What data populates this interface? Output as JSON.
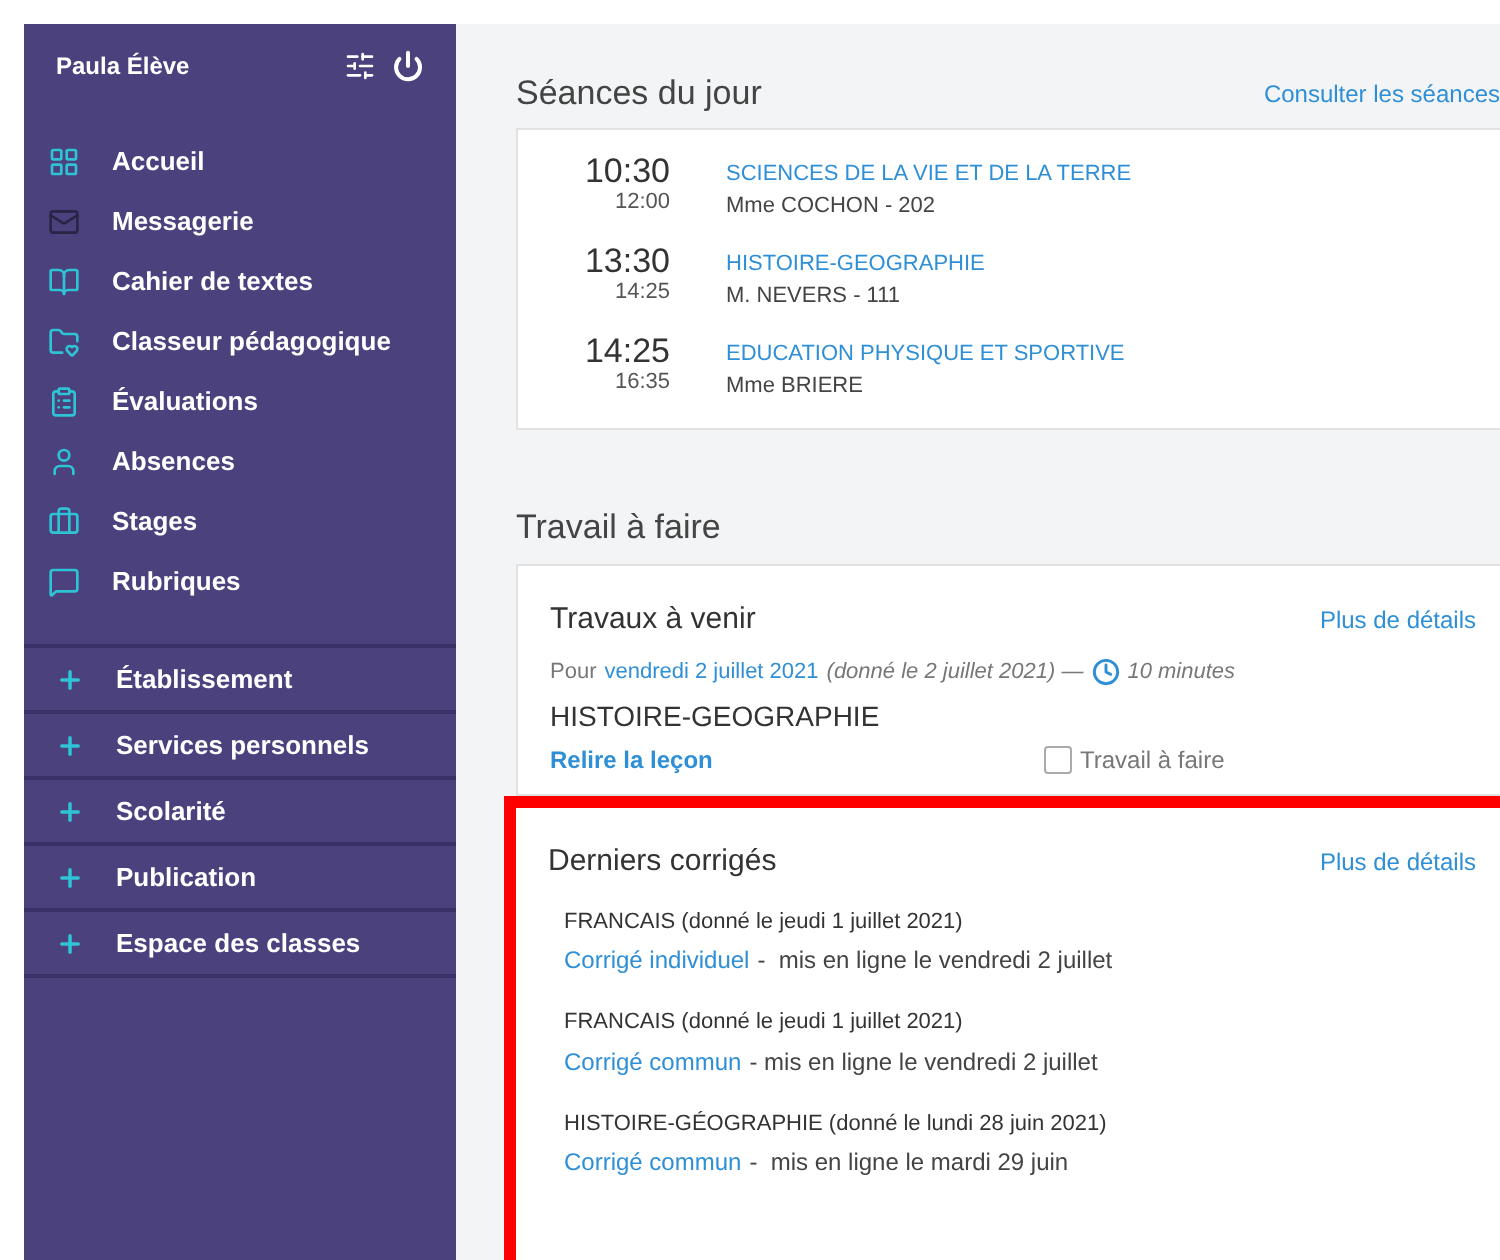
{
  "sidebar": {
    "user": "Paula Élève",
    "items": [
      {
        "label": "Accueil",
        "kind": "grid"
      },
      {
        "label": "Messagerie",
        "kind": "mail"
      },
      {
        "label": "Cahier de textes",
        "kind": "book"
      },
      {
        "label": "Classeur pédagogique",
        "kind": "folder"
      },
      {
        "label": "Évaluations",
        "kind": "clipboard"
      },
      {
        "label": "Absences",
        "kind": "person"
      },
      {
        "label": "Stages",
        "kind": "briefcase"
      },
      {
        "label": "Rubriques",
        "kind": "chat"
      }
    ],
    "sections": [
      {
        "label": "Établissement",
        "expanded": false
      },
      {
        "label": "Services personnels",
        "expanded": false
      },
      {
        "label": "Scolarité",
        "expanded": false
      },
      {
        "label": "Publication",
        "expanded": false
      },
      {
        "label": "Espace des classes",
        "expanded": false
      }
    ]
  },
  "seances": {
    "title": "Séances du jour",
    "link": "Consulter les séances",
    "rows": [
      {
        "start": "10:30",
        "end": "12:00",
        "subject": "SCIENCES DE LA VIE ET DE LA TERRE",
        "teacher": "Mme COCHON - 202"
      },
      {
        "start": "13:30",
        "end": "14:25",
        "subject": "HISTOIRE-GEOGRAPHIE",
        "teacher": "M. NEVERS - 111"
      },
      {
        "start": "14:25",
        "end": "16:35",
        "subject": "EDUCATION PHYSIQUE ET SPORTIVE",
        "teacher": "Mme BRIERE"
      }
    ]
  },
  "travail": {
    "title": "Travail à faire",
    "card_title": "Travaux à venir",
    "link": "Plus de détails",
    "pour": "Pour",
    "date": "vendredi 2 juillet 2021",
    "given": "(donné le 2 juillet 2021) —",
    "duration": "10 minutes",
    "subject": "HISTOIRE-GEOGRAPHIE",
    "task": "Relire la leçon",
    "checkbox": {
      "label": "Travail à faire",
      "checked": false
    }
  },
  "corriges": {
    "title": "Derniers corrigés",
    "link": "Plus de détails",
    "items": [
      {
        "heading": "FRANCAIS (donné le jeudi 1 juillet 2021)",
        "link": "Corrigé individuel",
        "note": "-  mis en ligne le vendredi 2 juillet"
      },
      {
        "heading": "FRANCAIS (donné le jeudi 1 juillet 2021)",
        "link": "Corrigé commun",
        "note": "- mis en ligne le vendredi 2 juillet"
      },
      {
        "heading": "HISTOIRE-GÉOGRAPHIE (donné le lundi 28 juin 2021)",
        "link": "Corrigé commun",
        "note": "-  mis en ligne le mardi 29 juin"
      }
    ]
  }
}
